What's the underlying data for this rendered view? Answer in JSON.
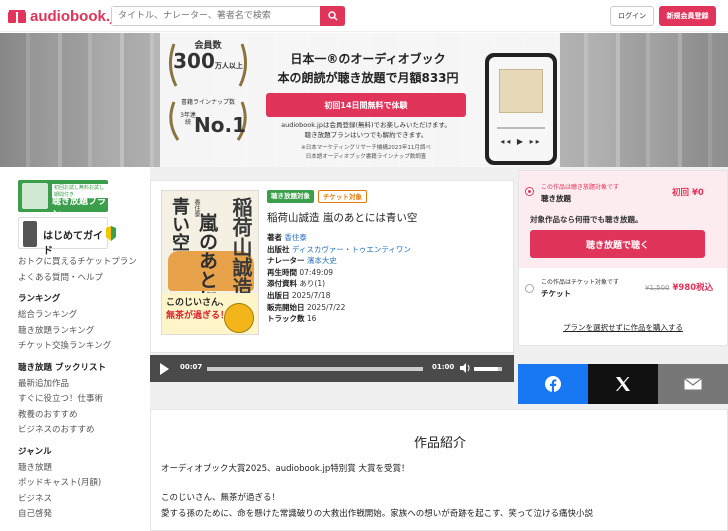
{
  "header": {
    "logo": "audiobook.jp",
    "search_placeholder": "タイトル、ナレーター、著者名で検索",
    "login": "ログイン",
    "signup": "新規会員登録"
  },
  "banner": {
    "members_label": "会員数",
    "members_value": "300",
    "members_unit": "万人以上",
    "lineup_label": "書籍ラインナップ数",
    "lineup_years": "3年連続",
    "lineup_rank": "No.1",
    "title_line1": "日本一®のオーディオブック",
    "title_line2": "本の朗読が聴き放題で月額833円",
    "cta": "初回14日間無料で体験",
    "note_line1": "audiobook.jpは会員登録(無料)でお楽しみいただけます。",
    "note_line2": "聴き放題プランはいつでも解約できます。",
    "foot_line1": "※日本マーケティングリサーチ機構2023年11月調べ",
    "foot_line2": "日本語オーディオブック書籍ラインナップ数調査"
  },
  "sidebar": {
    "banner_plan_small": "初回お試し無料お試し期間付き",
    "banner_plan": "聴き放題プラン",
    "banner_guide": "はじめてガイド",
    "links": [
      "おトクに買えるチケットプラン",
      "よくある質問・ヘルプ"
    ],
    "sections": [
      {
        "title": "ランキング",
        "items": [
          "総合ランキング",
          "聴き放題ランキング",
          "チケット交換ランキング"
        ]
      },
      {
        "title": "聴き放題 ブックリスト",
        "items": [
          "最新追加作品",
          "すぐに役立つ！仕事術",
          "教養のおすすめ",
          "ビジネスのおすすめ"
        ]
      },
      {
        "title": "ジャンル",
        "items": [
          "聴き放題",
          "ポッドキャスト(月額)",
          "ビジネス",
          "自己啓発"
        ]
      }
    ]
  },
  "product": {
    "tag1": "聴き放題対象",
    "tag2": "チケット対象",
    "title": "稲荷山誠造 嵐のあとには青い空",
    "author_label": "著者",
    "author": "香住泰",
    "publisher_label": "出版社",
    "publisher": "ディスカヴァー・トゥエンティワン",
    "narrator_label": "ナレーター",
    "narrator": "濱本大史",
    "duration_label": "再生時間",
    "duration": "07:49:09",
    "attachment_label": "添付資料",
    "attachment": "あり(1)",
    "pubdate_label": "出版日",
    "pubdate": "2025/7/18",
    "saledate_label": "販売開始日",
    "saledate": "2025/7/22",
    "tracks_label": "トラック数",
    "tracks": "16",
    "cover_title": "稲荷山誠造",
    "cover_sub1": "嵐のあとには",
    "cover_sub2": "青い空",
    "cover_author": "香住泰",
    "cover_band1": "このじいさん、",
    "cover_band2": "無茶が過ぎる！"
  },
  "player": {
    "current": "00:07",
    "total": "01:00",
    "progress": 0.0,
    "volume": 0.85
  },
  "purchase": {
    "opt1_small": "この作品は聴き放題対象です",
    "opt1_name": "聴き放題",
    "opt1_price": "初回 ¥0",
    "opt1_desc": "対象作品なら何冊でも聴き放題。",
    "opt1_btn": "聴き放題で聴く",
    "opt2_small": "この作品はチケット対象です",
    "opt2_name": "チケット",
    "opt2_old": "¥1,500",
    "opt2_price": "¥980税込",
    "no_plan": "プランを選択せずに作品を購入する"
  },
  "intro": {
    "title": "作品紹介",
    "line1": "オーディオブック大賞2025、audiobook.jp特別賞 大賞を受賞！",
    "line2": "このじいさん、無茶が過ぎる！",
    "line3": "愛する孫のために、命を懸けた常識破りの大救出作戦開始。家族への想いが奇跡を起こす、笑って泣ける痛快小説"
  },
  "colors": {
    "accent": "#e0345a",
    "green": "#3a9e4a",
    "facebook": "#1877f2"
  }
}
